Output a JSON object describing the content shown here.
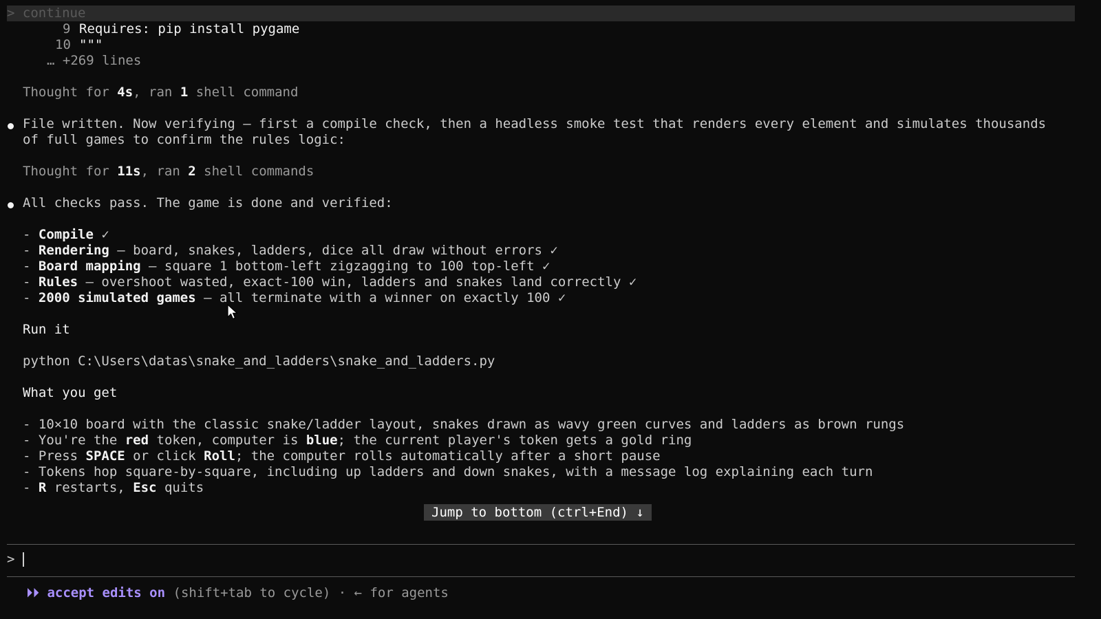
{
  "prompt_echo": "> continue",
  "code": {
    "line9_num": "9",
    "line9_text": "Requires: pip install pygame",
    "line10_num": "10",
    "line10_text": "\"\"\"",
    "more": "… +269 lines"
  },
  "thought1": {
    "pre": "Thought for ",
    "time": "4s",
    "mid": ", ran ",
    "count": "1",
    "post": " shell command"
  },
  "msg1": {
    "line1": "File written. Now verifying — first a compile check, then a headless smoke test that renders every element and simulates thousands",
    "line2": "of full games to confirm the rules logic:"
  },
  "thought2": {
    "pre": "Thought for ",
    "time": "11s",
    "mid": ", ran ",
    "count": "2",
    "post": " shell commands"
  },
  "msg2": {
    "line1": "All checks pass. The game is done and verified:"
  },
  "checks": [
    {
      "bold": "Compile",
      "rest": " ✓"
    },
    {
      "bold": "Rendering",
      "rest": " — board, snakes, ladders, dice all draw without errors ✓"
    },
    {
      "bold": "Board mapping",
      "rest": " — square 1 bottom-left zigzagging to 100 top-left ✓"
    },
    {
      "bold": "Rules",
      "rest": " — overshoot wasted, exact-100 win, ladders and snakes land correctly ✓"
    },
    {
      "bold": "2000 simulated games",
      "rest": " — all terminate with a winner on exactly 100 ✓"
    }
  ],
  "dash": "- ",
  "run_heading": "Run it",
  "run_command": "python C:\\Users\\datas\\snake_and_ladders\\snake_and_ladders.py",
  "get_heading": "What you get",
  "features": {
    "f1": "10×10 board with the classic snake/ladder layout, snakes drawn as wavy green curves and ladders as brown rungs",
    "f2_a": "You're the ",
    "f2_b": "red",
    "f2_c": " token, computer is ",
    "f2_d": "blue",
    "f2_e": "; the current player's token gets a gold ring",
    "f3_a": "Press ",
    "f3_b": "SPACE",
    "f3_c": " or click ",
    "f3_d": "Roll",
    "f3_e": "; the computer rolls automatically after a short pause",
    "f4": "Tokens hop square-by-square, including up ladders and down snakes, with a message log explaining each turn",
    "f5_a": "R",
    "f5_b": " restarts, ",
    "f5_c": "Esc",
    "f5_d": " quits"
  },
  "jump_button": "Jump to bottom (ctrl+End) ↓",
  "input_prompt": ">",
  "status": {
    "icon": "⏵⏵",
    "mode": "accept edits on",
    "hint": " (shift+tab to cycle) · ← for agents"
  },
  "colors": {
    "background": "#0c0c0c",
    "text": "#cccccc",
    "bold": "#f2f2f2",
    "accent": "#a990ff"
  }
}
